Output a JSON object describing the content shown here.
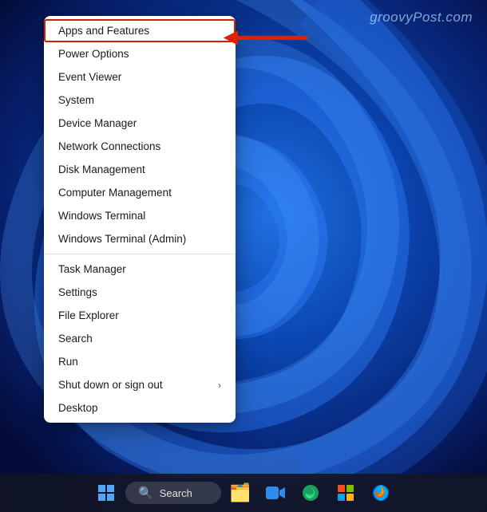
{
  "watermark": "groovyPost.com",
  "context_menu": {
    "items": [
      {
        "id": "apps-features",
        "label": "Apps and Features",
        "highlighted": true,
        "has_submenu": false
      },
      {
        "id": "power-options",
        "label": "Power Options",
        "highlighted": false,
        "has_submenu": false
      },
      {
        "id": "event-viewer",
        "label": "Event Viewer",
        "highlighted": false,
        "has_submenu": false
      },
      {
        "id": "system",
        "label": "System",
        "highlighted": false,
        "has_submenu": false
      },
      {
        "id": "device-manager",
        "label": "Device Manager",
        "highlighted": false,
        "has_submenu": false
      },
      {
        "id": "network-connections",
        "label": "Network Connections",
        "highlighted": false,
        "has_submenu": false
      },
      {
        "id": "disk-management",
        "label": "Disk Management",
        "highlighted": false,
        "has_submenu": false
      },
      {
        "id": "computer-management",
        "label": "Computer Management",
        "highlighted": false,
        "has_submenu": false
      },
      {
        "id": "windows-terminal",
        "label": "Windows Terminal",
        "highlighted": false,
        "has_submenu": false
      },
      {
        "id": "windows-terminal-admin",
        "label": "Windows Terminal (Admin)",
        "highlighted": false,
        "has_submenu": false,
        "divider_after": true
      },
      {
        "id": "task-manager",
        "label": "Task Manager",
        "highlighted": false,
        "has_submenu": false
      },
      {
        "id": "settings",
        "label": "Settings",
        "highlighted": false,
        "has_submenu": false
      },
      {
        "id": "file-explorer",
        "label": "File Explorer",
        "highlighted": false,
        "has_submenu": false
      },
      {
        "id": "search",
        "label": "Search",
        "highlighted": false,
        "has_submenu": false
      },
      {
        "id": "run",
        "label": "Run",
        "highlighted": false,
        "has_submenu": false
      },
      {
        "id": "shutdown-signout",
        "label": "Shut down or sign out",
        "highlighted": false,
        "has_submenu": true
      },
      {
        "id": "desktop",
        "label": "Desktop",
        "highlighted": false,
        "has_submenu": false
      }
    ]
  },
  "taskbar": {
    "search_placeholder": "Search",
    "icons": [
      {
        "id": "windows-start",
        "symbol": "⊞",
        "color": "#58a4f4"
      },
      {
        "id": "task-view",
        "symbol": "⧉",
        "color": "#ffffff"
      },
      {
        "id": "file-explorer",
        "symbol": "📁",
        "color": "#f0c040"
      },
      {
        "id": "zoom",
        "symbol": "🎥",
        "color": "#2d8cf0"
      },
      {
        "id": "edge",
        "symbol": "🌊",
        "color": "#25a9e0"
      },
      {
        "id": "microsoft-store",
        "symbol": "🪟",
        "color": "#8050d0"
      },
      {
        "id": "firefox",
        "symbol": "🦊",
        "color": "#e66000"
      }
    ]
  }
}
